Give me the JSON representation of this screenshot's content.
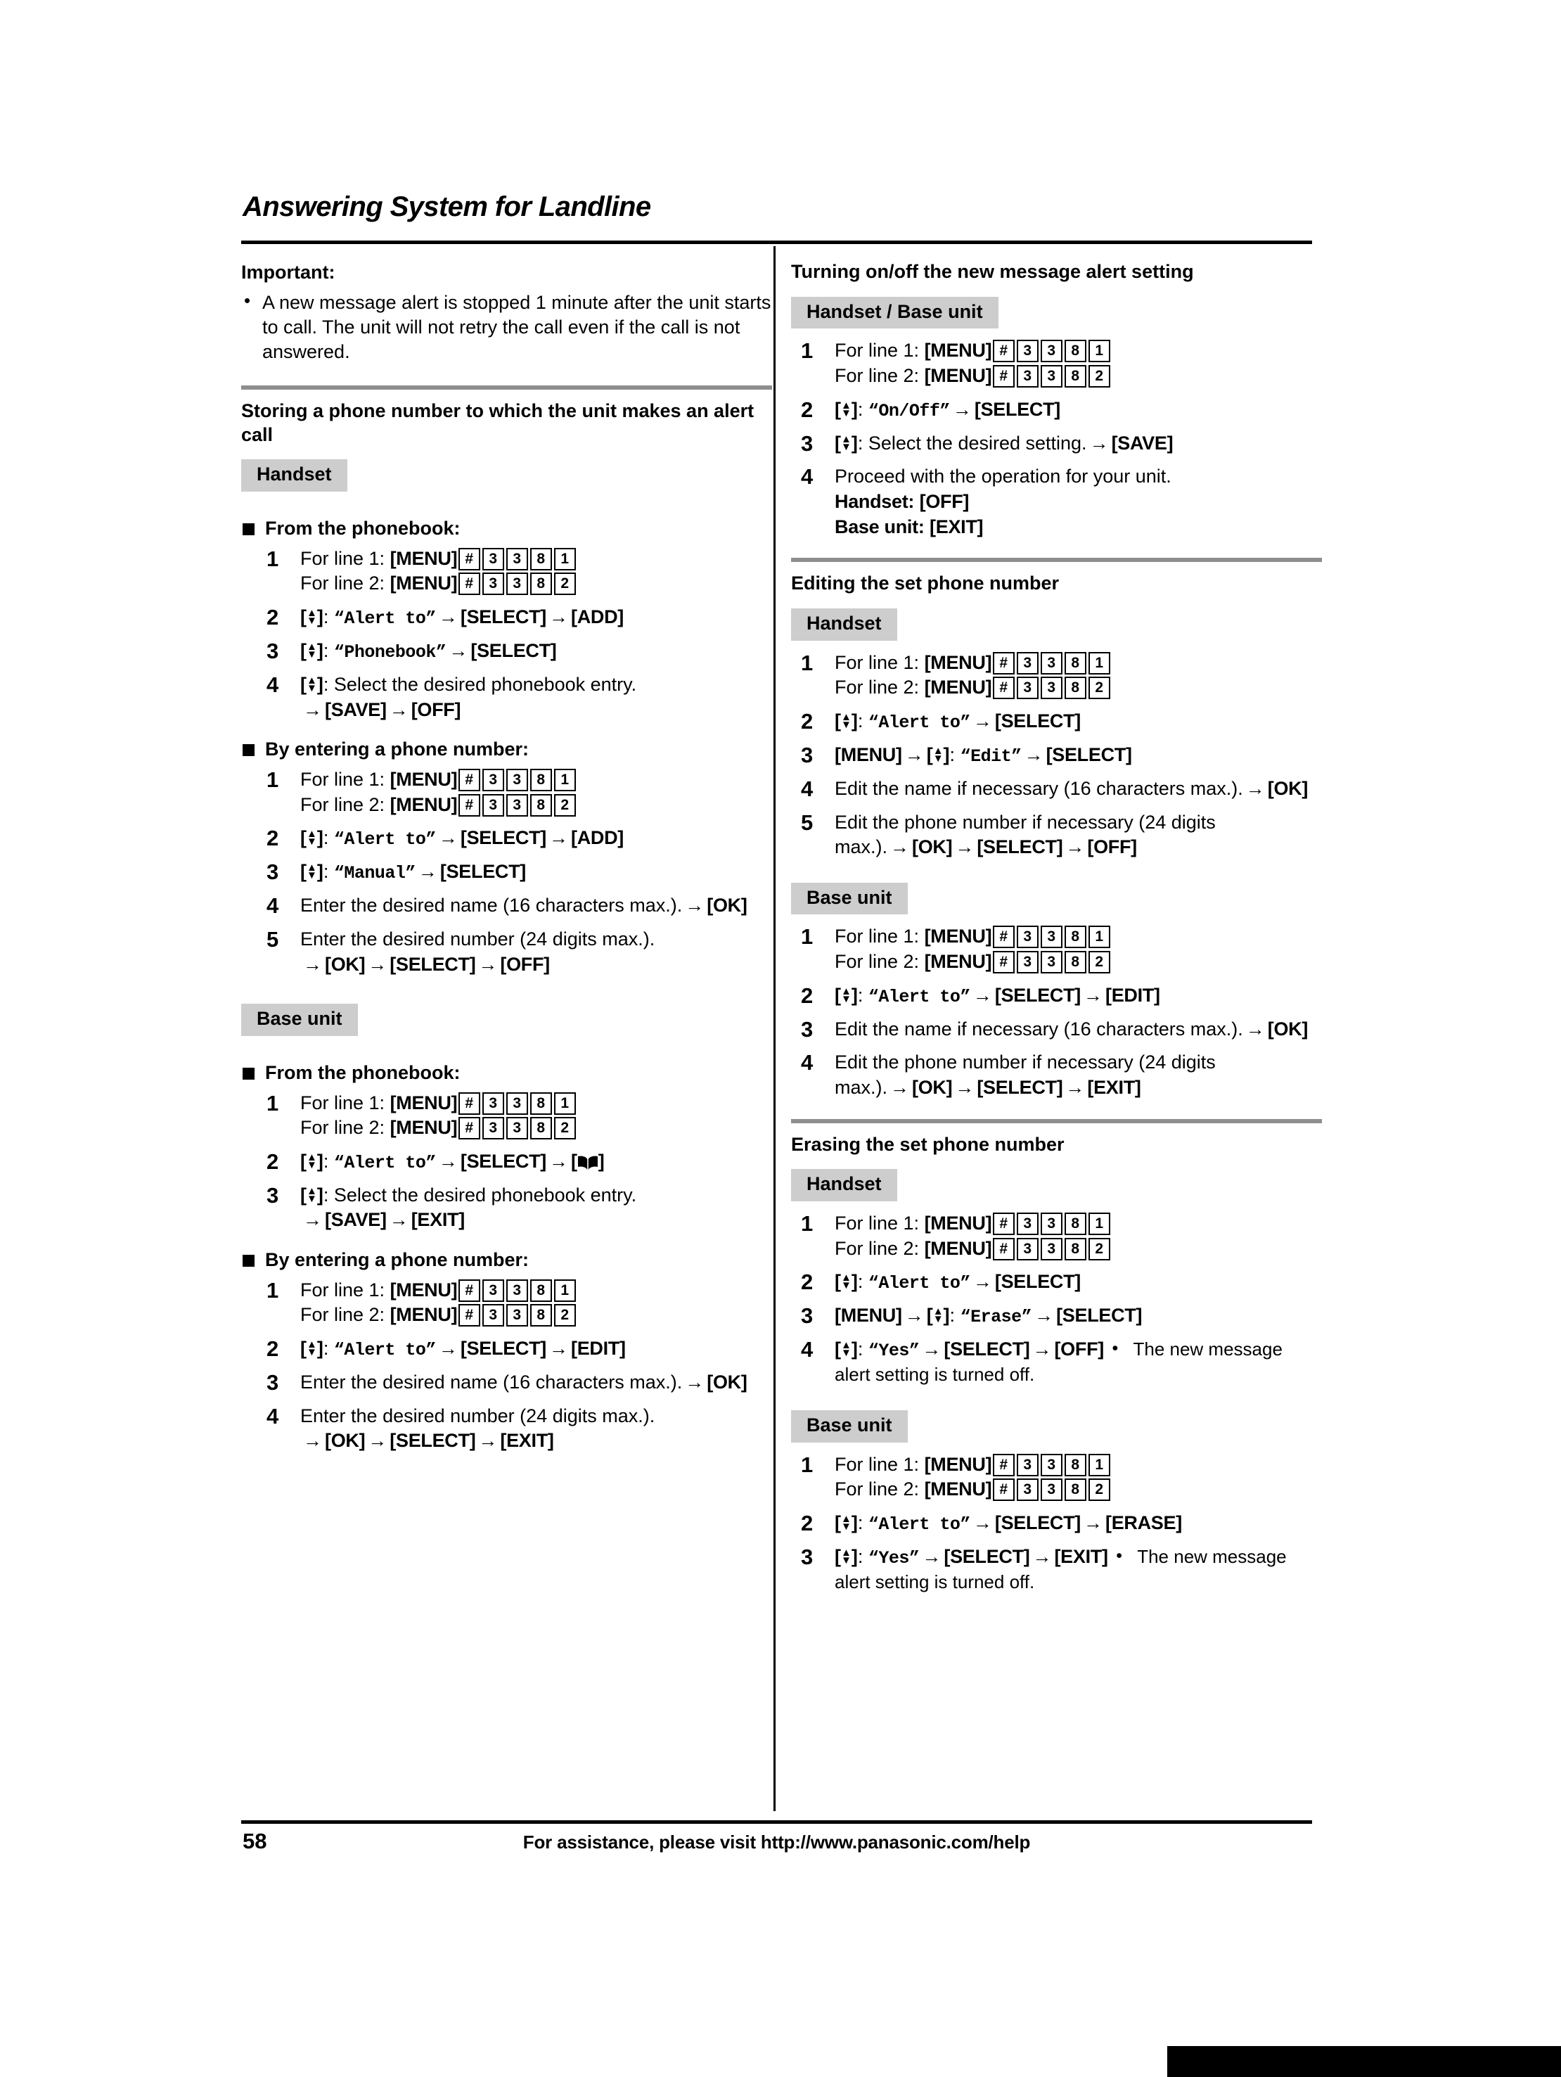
{
  "document": {
    "chapter_title": "Answering System for Landline",
    "page_number": "58",
    "footer_text": "For assistance, please visit http://www.panasonic.com/help"
  },
  "glyphs": {
    "arrow": "→",
    "nav_up": "▲",
    "nav_down": "▼",
    "bracket_open": "[",
    "bracket_close": "]",
    "hash": "#",
    "phonebook_icon": "phonebook-book-icon"
  },
  "left_column": {
    "important": {
      "heading": "Important:",
      "bullets": [
        "A new message alert is stopped 1 minute after the unit starts to call. The unit will not retry the call even if the call is not answered."
      ]
    },
    "storing": {
      "heading": "Storing a phone number to which the unit makes an alert call",
      "badge_handset": "Handset",
      "badge_base_unit": "Base unit",
      "handset": {
        "from_phonebook": {
          "title": "From the phonebook:",
          "steps": {
            "s1_line1_label": "For line 1:",
            "s1_line1_key": "[MENU]",
            "s1_line1_digits": [
              "#",
              "3",
              "3",
              "8",
              "1"
            ],
            "s1_line2_label": "For line 2:",
            "s1_line2_key": "[MENU]",
            "s1_line2_digits": [
              "#",
              "3",
              "3",
              "8",
              "2"
            ],
            "s2_quoted": "“Alert to”",
            "s2_key1": "[SELECT]",
            "s2_key2": "[ADD]",
            "s3_quoted": "“Phonebook”",
            "s3_key1": "[SELECT]",
            "s4_text": "Select the desired phonebook entry.",
            "s4_key1": "[SAVE]",
            "s4_key2": "[OFF]"
          }
        },
        "by_entering": {
          "title": "By entering a phone number:",
          "steps": {
            "s1_line1_label": "For line 1:",
            "s1_line1_key": "[MENU]",
            "s1_line1_digits": [
              "#",
              "3",
              "3",
              "8",
              "1"
            ],
            "s1_line2_label": "For line 2:",
            "s1_line2_key": "[MENU]",
            "s1_line2_digits": [
              "#",
              "3",
              "3",
              "8",
              "2"
            ],
            "s2_quoted": "“Alert to”",
            "s2_key1": "[SELECT]",
            "s2_key2": "[ADD]",
            "s3_quoted": "“Manual”",
            "s3_key1": "[SELECT]",
            "s4_text": "Enter the desired name (16 characters max.).",
            "s4_key1": "[OK]",
            "s5_text": "Enter the desired number (24 digits max.).",
            "s5_key1": "[OK]",
            "s5_key2": "[SELECT]",
            "s5_key3": "[OFF]"
          }
        }
      },
      "base_unit": {
        "from_phonebook": {
          "title": "From the phonebook:",
          "steps": {
            "s1_line1_label": "For line 1:",
            "s1_line1_key": "[MENU]",
            "s1_line1_digits": [
              "#",
              "3",
              "3",
              "8",
              "1"
            ],
            "s1_line2_label": "For line 2:",
            "s1_line2_key": "[MENU]",
            "s1_line2_digits": [
              "#",
              "3",
              "3",
              "8",
              "2"
            ],
            "s2_quoted": "“Alert to”",
            "s2_key1": "[SELECT]",
            "s2_key2_icon": "phonebook-book-icon",
            "s3_text": "Select the desired phonebook entry.",
            "s3_key1": "[SAVE]",
            "s3_key2": "[EXIT]"
          }
        },
        "by_entering": {
          "title": "By entering a phone number:",
          "steps": {
            "s1_line1_label": "For line 1:",
            "s1_line1_key": "[MENU]",
            "s1_line1_digits": [
              "#",
              "3",
              "3",
              "8",
              "1"
            ],
            "s1_line2_label": "For line 2:",
            "s1_line2_key": "[MENU]",
            "s1_line2_digits": [
              "#",
              "3",
              "3",
              "8",
              "2"
            ],
            "s2_quoted": "“Alert to”",
            "s2_key1": "[SELECT]",
            "s2_key2": "[EDIT]",
            "s3_text": "Enter the desired name (16 characters max.).",
            "s3_key1": "[OK]",
            "s4_text": "Enter the desired number (24 digits max.).",
            "s4_key1": "[OK]",
            "s4_key2": "[SELECT]",
            "s4_key3": "[EXIT]"
          }
        }
      }
    }
  },
  "right_column": {
    "turning_onoff": {
      "heading": "Turning on/off the new message alert setting",
      "badge": "Handset / Base unit",
      "steps": {
        "s1_line1_label": "For line 1:",
        "s1_line1_key": "[MENU]",
        "s1_line1_digits": [
          "#",
          "3",
          "3",
          "8",
          "1"
        ],
        "s1_line2_label": "For line 2:",
        "s1_line2_key": "[MENU]",
        "s1_line2_digits": [
          "#",
          "3",
          "3",
          "8",
          "2"
        ],
        "s2_quoted": "“On/Off”",
        "s2_key1": "[SELECT]",
        "s3_text": "Select the desired setting.",
        "s3_key1": "[SAVE]",
        "s4_text": "Proceed with the operation for your unit.",
        "s4_handset_label": "Handset:",
        "s4_handset_key": "[OFF]",
        "s4_base_label": "Base unit:",
        "s4_base_key": "[EXIT]"
      }
    },
    "editing": {
      "heading": "Editing the set phone number",
      "badge_handset": "Handset",
      "badge_base_unit": "Base unit",
      "handset_steps": {
        "s1_line1_label": "For line 1:",
        "s1_line1_key": "[MENU]",
        "s1_line1_digits": [
          "#",
          "3",
          "3",
          "8",
          "1"
        ],
        "s1_line2_label": "For line 2:",
        "s1_line2_key": "[MENU]",
        "s1_line2_digits": [
          "#",
          "3",
          "3",
          "8",
          "2"
        ],
        "s2_quoted": "“Alert to”",
        "s2_key1": "[SELECT]",
        "s3_key0": "[MENU]",
        "s3_quoted": "“Edit”",
        "s3_key1": "[SELECT]",
        "s4_text": "Edit the name if necessary (16 characters max.).",
        "s4_key1": "[OK]",
        "s5_text": "Edit the phone number if necessary (24 digits max.).",
        "s5_key1": "[OK]",
        "s5_key2": "[SELECT]",
        "s5_key3": "[OFF]"
      },
      "base_steps": {
        "s1_line1_label": "For line 1:",
        "s1_line1_key": "[MENU]",
        "s1_line1_digits": [
          "#",
          "3",
          "3",
          "8",
          "1"
        ],
        "s1_line2_label": "For line 2:",
        "s1_line2_key": "[MENU]",
        "s1_line2_digits": [
          "#",
          "3",
          "3",
          "8",
          "2"
        ],
        "s2_quoted": "“Alert to”",
        "s2_key1": "[SELECT]",
        "s2_key2": "[EDIT]",
        "s3_text": "Edit the name if necessary (16 characters max.).",
        "s3_key1": "[OK]",
        "s4_text": "Edit the phone number if necessary (24 digits max.).",
        "s4_key1": "[OK]",
        "s4_key2": "[SELECT]",
        "s4_key3": "[EXIT]"
      }
    },
    "erasing": {
      "heading": "Erasing the set phone number",
      "badge_handset": "Handset",
      "badge_base_unit": "Base unit",
      "handset_steps": {
        "s1_line1_label": "For line 1:",
        "s1_line1_key": "[MENU]",
        "s1_line1_digits": [
          "#",
          "3",
          "3",
          "8",
          "1"
        ],
        "s1_line2_label": "For line 2:",
        "s1_line2_key": "[MENU]",
        "s1_line2_digits": [
          "#",
          "3",
          "3",
          "8",
          "2"
        ],
        "s2_quoted": "“Alert to”",
        "s2_key1": "[SELECT]",
        "s3_key0": "[MENU]",
        "s3_quoted": "“Erase”",
        "s3_key1": "[SELECT]",
        "s4_quoted": "“Yes”",
        "s4_key1": "[SELECT]",
        "s4_key2": "[OFF]",
        "s4_note": "The new message alert setting is turned off."
      },
      "base_steps": {
        "s1_line1_label": "For line 1:",
        "s1_line1_key": "[MENU]",
        "s1_line1_digits": [
          "#",
          "3",
          "3",
          "8",
          "1"
        ],
        "s1_line2_label": "For line 2:",
        "s1_line2_key": "[MENU]",
        "s1_line2_digits": [
          "#",
          "3",
          "3",
          "8",
          "2"
        ],
        "s2_quoted": "“Alert to”",
        "s2_key1": "[SELECT]",
        "s2_key2": "[ERASE]",
        "s3_quoted": "“Yes”",
        "s3_key1": "[SELECT]",
        "s3_key2": "[EXIT]",
        "s3_note": "The new message alert setting is turned off."
      }
    }
  }
}
